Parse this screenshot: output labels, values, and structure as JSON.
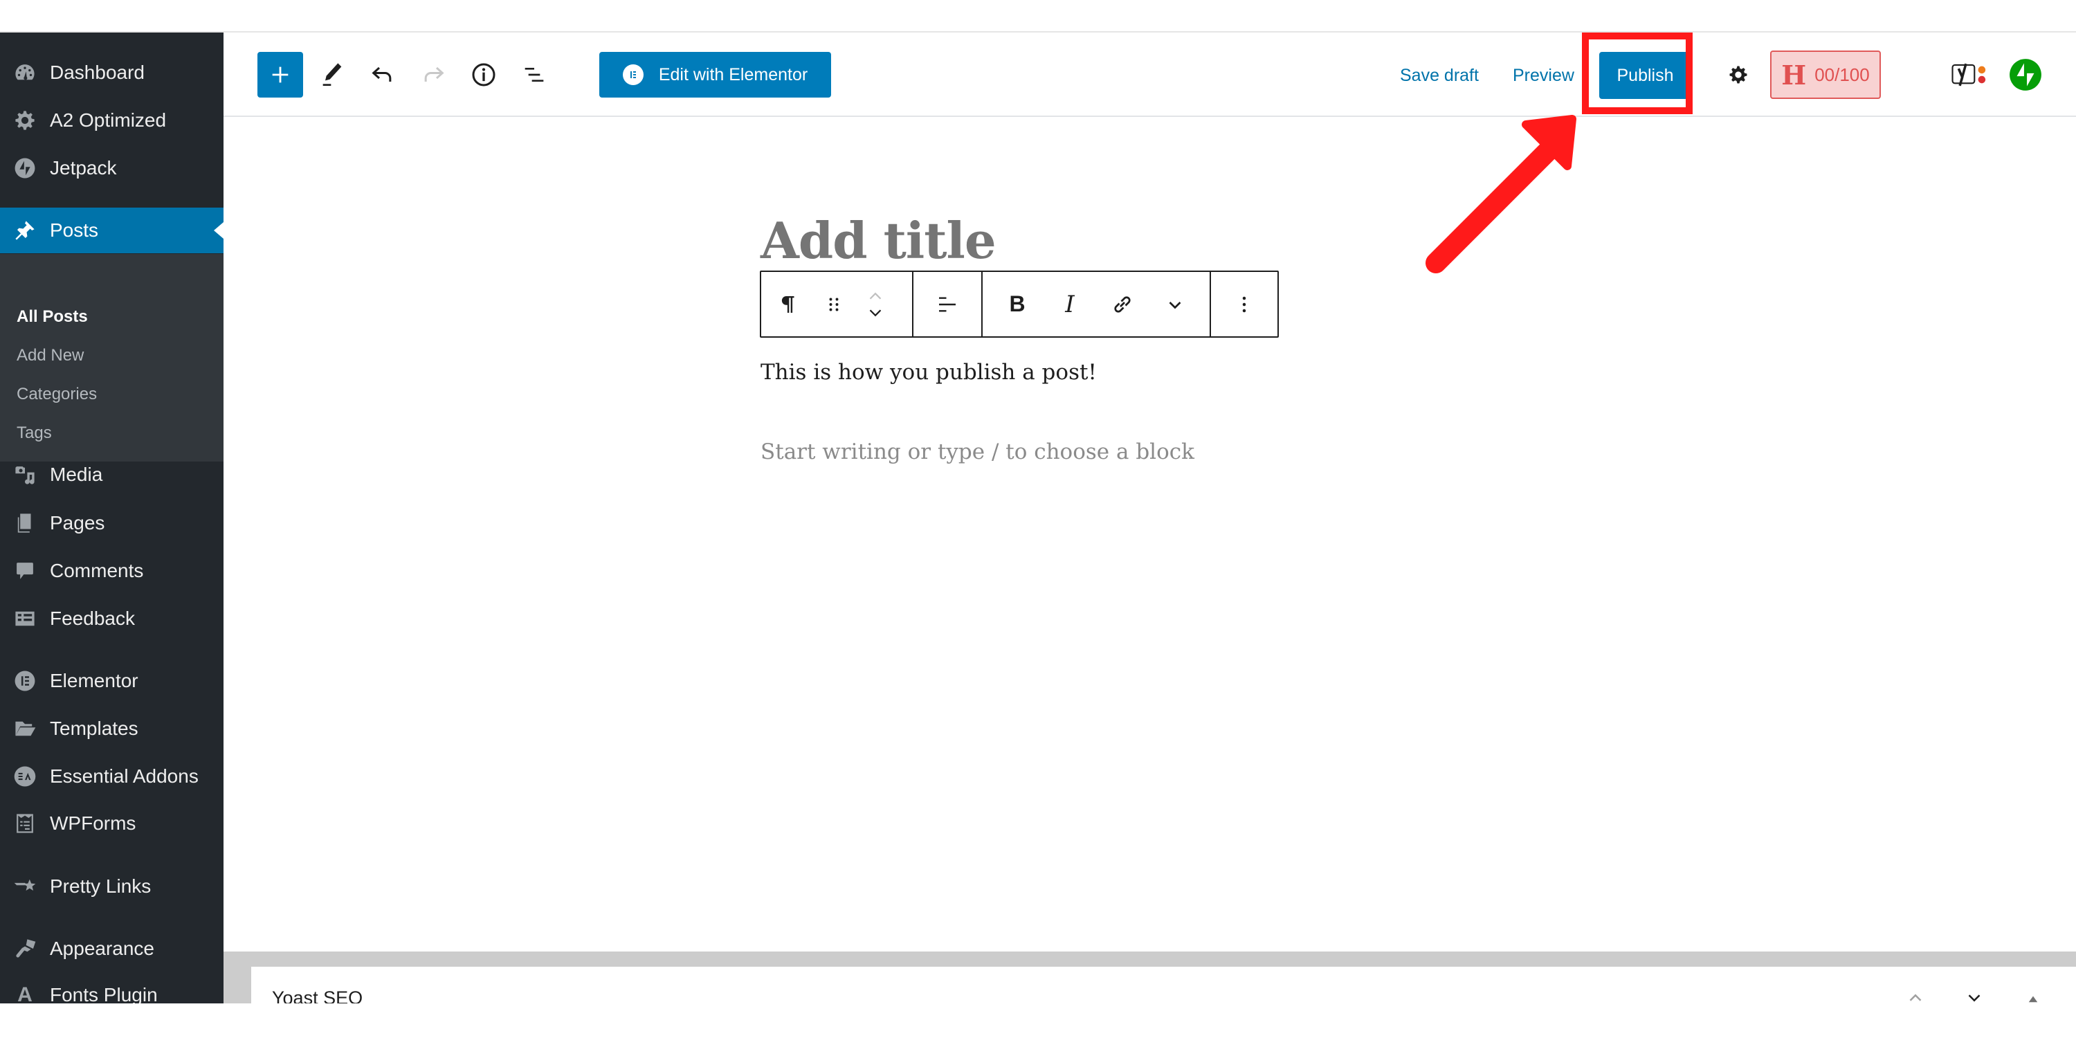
{
  "sidebar": {
    "items": [
      {
        "label": "Dashboard",
        "icon": "dashboard-icon"
      },
      {
        "label": "A2 Optimized",
        "icon": "gear-icon"
      },
      {
        "label": "Jetpack",
        "icon": "jetpack-icon"
      },
      {
        "label": "Posts",
        "icon": "pin-icon",
        "active": true
      },
      {
        "label": "Media",
        "icon": "media-icon"
      },
      {
        "label": "Pages",
        "icon": "pages-icon"
      },
      {
        "label": "Comments",
        "icon": "comment-icon"
      },
      {
        "label": "Feedback",
        "icon": "feedback-icon"
      },
      {
        "label": "Elementor",
        "icon": "elementor-icon"
      },
      {
        "label": "Templates",
        "icon": "folder-icon"
      },
      {
        "label": "Essential Addons",
        "icon": "essential-addons-icon"
      },
      {
        "label": "WPForms",
        "icon": "wpforms-icon"
      },
      {
        "label": "Pretty Links",
        "icon": "star-link-icon"
      },
      {
        "label": "Appearance",
        "icon": "paintbrush-icon"
      },
      {
        "label": "Fonts Plugin",
        "icon": "font-a-icon"
      }
    ],
    "submenu": [
      {
        "label": "All Posts",
        "current": true
      },
      {
        "label": "Add New"
      },
      {
        "label": "Categories"
      },
      {
        "label": "Tags"
      }
    ],
    "fonts_icon_glyph": "A"
  },
  "header": {
    "add_block": "plus-icon",
    "tools": [
      "pencil-icon",
      "undo-icon",
      "redo-icon",
      "info-icon",
      "list-view-icon"
    ],
    "edit_with_elementor": "Edit with Elementor",
    "save_draft": "Save draft",
    "preview": "Preview",
    "publish": "Publish",
    "headline_score": {
      "letter": "H",
      "score": "00/100"
    },
    "colors": {
      "accent": "#007cba",
      "link": "#0073aa",
      "badge_bg": "#f8d2d2",
      "badge_text": "#e05050",
      "annotation": "#ff1a1a",
      "jetpack": "#069e08"
    }
  },
  "editor": {
    "title_placeholder": "Add title",
    "paragraph": "This is how you publish a post!",
    "block_placeholder": "Start writing or type / to choose a block",
    "toolbar": {
      "bold": "B",
      "italic": "I"
    }
  },
  "metabox": {
    "title": "Yoast SEO"
  }
}
